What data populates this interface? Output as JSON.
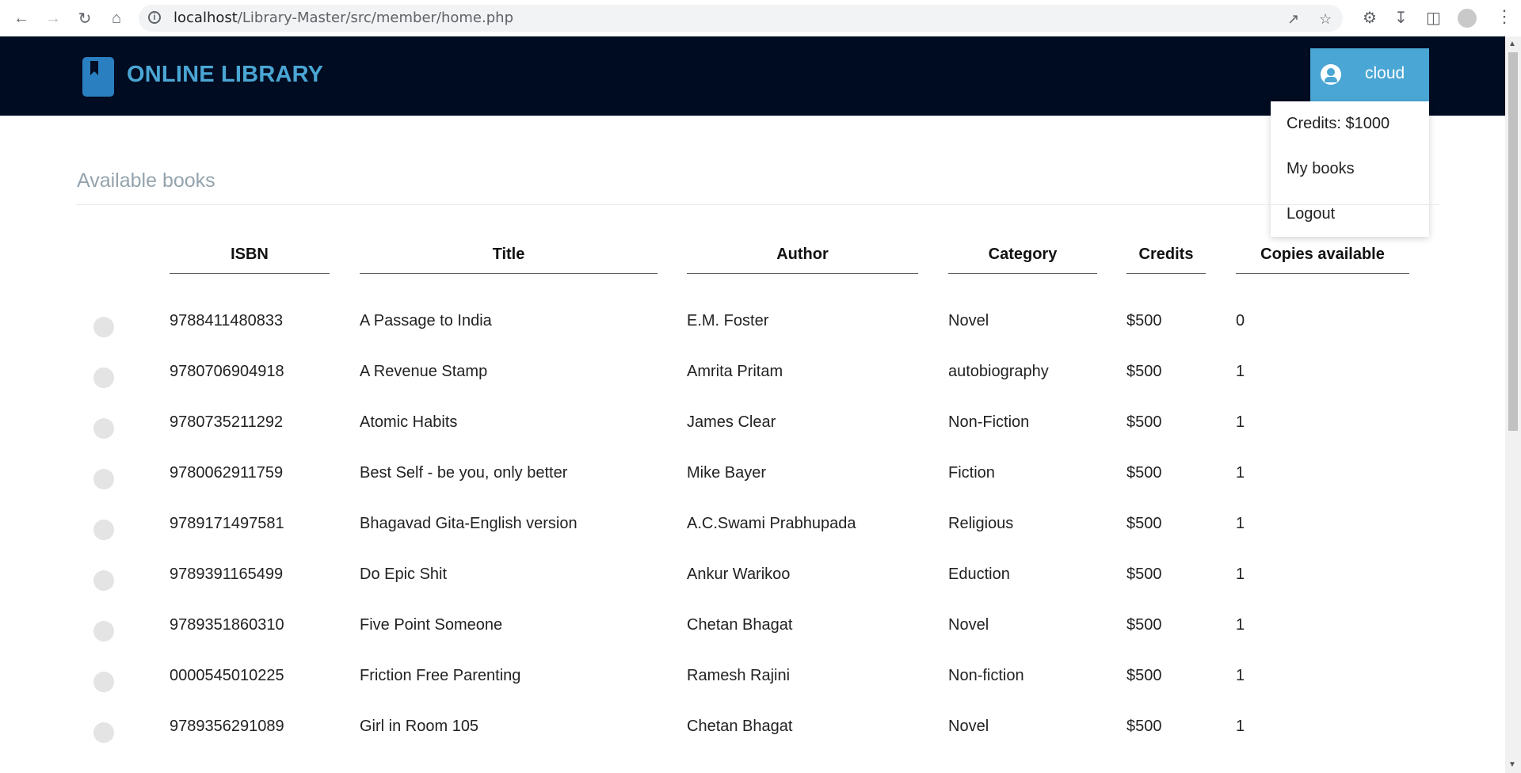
{
  "browser": {
    "url_host": "localhost",
    "url_path": "/Library-Master/src/member/home.php",
    "icons": [
      "back-icon",
      "forward-icon",
      "reload-icon",
      "home-icon",
      "info-icon",
      "share-icon",
      "star-icon",
      "extensions-icon",
      "download-icon",
      "sidepanel-icon",
      "profile-icon",
      "menu-icon"
    ]
  },
  "header": {
    "brand": "ONLINE LIBRARY",
    "username": "cloud"
  },
  "dropdown": {
    "credits": "Credits: $1000",
    "my_books": "My books",
    "logout": "Logout"
  },
  "page": {
    "section_title": "Available books"
  },
  "table": {
    "columns": [
      "ISBN",
      "Title",
      "Author",
      "Category",
      "Credits",
      "Copies available"
    ],
    "rows": [
      {
        "isbn": "9788411480833",
        "title": "A Passage to India",
        "author": "E.M. Foster",
        "category": "Novel",
        "credits": "$500",
        "copies": "0"
      },
      {
        "isbn": "9780706904918",
        "title": "A Revenue Stamp",
        "author": "Amrita Pritam",
        "category": "autobiography",
        "credits": "$500",
        "copies": "1"
      },
      {
        "isbn": "9780735211292",
        "title": "Atomic Habits",
        "author": "James Clear",
        "category": "Non-Fiction",
        "credits": "$500",
        "copies": "1"
      },
      {
        "isbn": "9780062911759",
        "title": "Best Self - be you, only better",
        "author": "Mike Bayer",
        "category": "Fiction",
        "credits": "$500",
        "copies": "1"
      },
      {
        "isbn": "9789171497581",
        "title": "Bhagavad Gita-English version",
        "author": "A.C.Swami Prabhupada",
        "category": "Religious",
        "credits": "$500",
        "copies": "1"
      },
      {
        "isbn": "9789391165499",
        "title": "Do Epic Shit",
        "author": "Ankur Warikoo",
        "category": "Eduction",
        "credits": "$500",
        "copies": "1"
      },
      {
        "isbn": "9789351860310",
        "title": "Five Point Someone",
        "author": "Chetan Bhagat",
        "category": "Novel",
        "credits": "$500",
        "copies": "1"
      },
      {
        "isbn": "0000545010225",
        "title": "Friction Free Parenting",
        "author": "Ramesh Rajini",
        "category": "Non-fiction",
        "credits": "$500",
        "copies": "1"
      },
      {
        "isbn": "9789356291089",
        "title": "Girl in Room 105",
        "author": "Chetan Bhagat",
        "category": "Novel",
        "credits": "$500",
        "copies": "1"
      }
    ]
  }
}
